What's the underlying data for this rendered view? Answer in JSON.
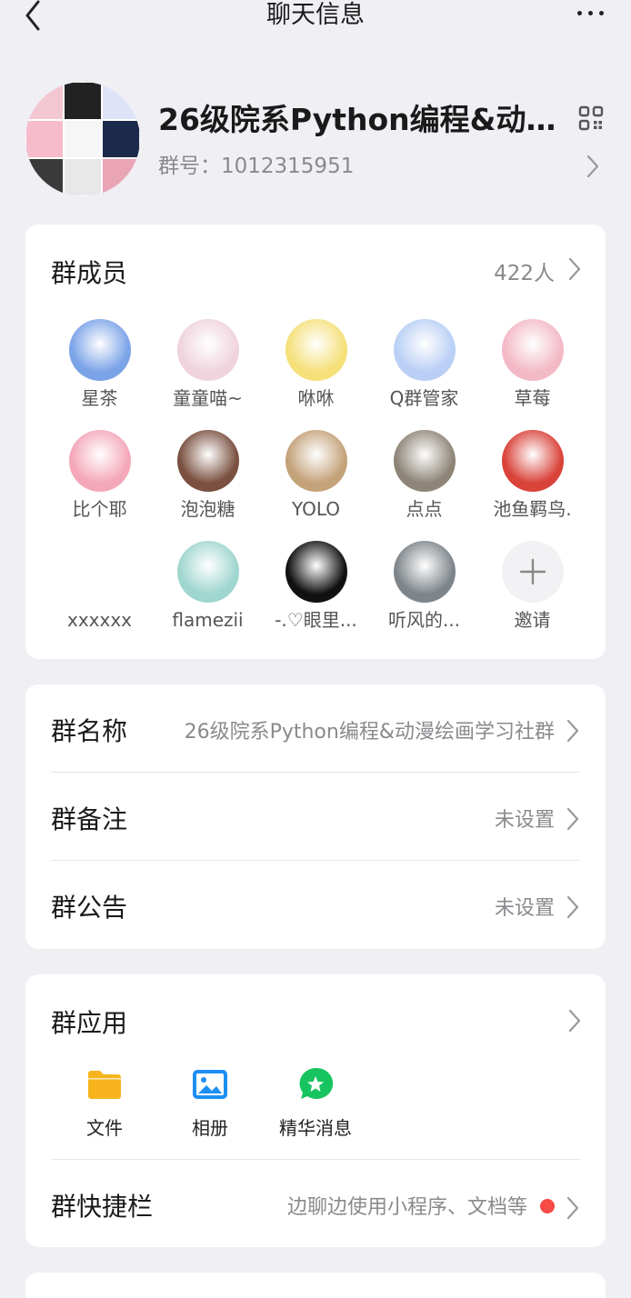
{
  "nav": {
    "title": "聊天信息"
  },
  "group": {
    "name": "26级院系Python编程&动漫...",
    "id_text": "群号：1012315951"
  },
  "members": {
    "title": "群成员",
    "count": "422人",
    "list": [
      {
        "name": "星茶",
        "color": "#7ba3e8"
      },
      {
        "name": "童童喵~",
        "color": "#f0d3dc"
      },
      {
        "name": "咻咻",
        "color": "#f5e07a"
      },
      {
        "name": "Q群管家",
        "color": "#b9cff5"
      },
      {
        "name": "草莓",
        "color": "#f3b9c6"
      },
      {
        "name": "比个耶",
        "color": "#f4a7b9"
      },
      {
        "name": "泡泡糖",
        "color": "#7a5040"
      },
      {
        "name": "YOLO",
        "color": "#c4a27a"
      },
      {
        "name": "点点",
        "color": "#8e8578"
      },
      {
        "name": "池鱼羁鸟.",
        "color": "#d9433a"
      },
      {
        "name": "xxxxxx",
        "color": "#ffffff"
      },
      {
        "name": "flamezii",
        "color": "#9fd6cf"
      },
      {
        "name": "-.♡眼里...",
        "color": "#111111"
      },
      {
        "name": "听风的...",
        "color": "#7e858a"
      }
    ],
    "invite_label": "邀请"
  },
  "info": {
    "name_label": "群名称",
    "name_value": "26级院系Python编程&动漫绘画学习社群",
    "remark_label": "群备注",
    "remark_value": "未设置",
    "notice_label": "群公告",
    "notice_value": "未设置"
  },
  "apps": {
    "title": "群应用",
    "items": [
      {
        "label": "文件",
        "icon": "folder-icon"
      },
      {
        "label": "相册",
        "icon": "photo-album-icon"
      },
      {
        "label": "精华消息",
        "icon": "star-message-icon"
      }
    ],
    "quick_label": "群快捷栏",
    "quick_value": "边聊边使用小程序、文档等"
  }
}
